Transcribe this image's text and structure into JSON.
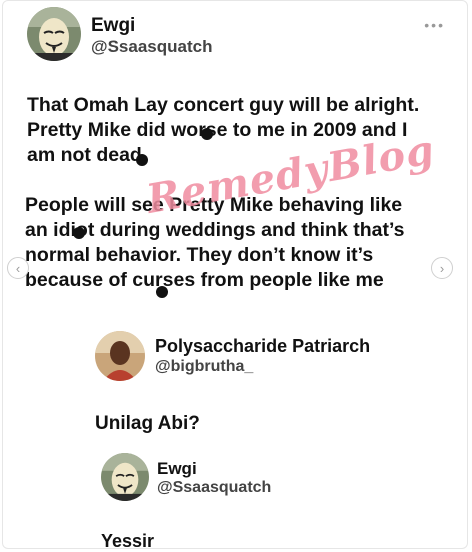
{
  "tweet1": {
    "name": "Ewgi",
    "handle": "@Ssaasquatch",
    "paragraph1": "That Omah Lay concert guy will be alright.\nPretty Mike did worse to me in 2009 and I\nam not dead",
    "paragraph2": "People will see Pretty Mike behaving like\nan idiot during weddings and think that’s\nnormal behavior. They don’t  know it’s\nbecause of curses from people like me"
  },
  "tweet2": {
    "name": "Polysaccharide Patriarch",
    "handle": "@bigbrutha_",
    "text": "Unilag Abi?"
  },
  "tweet3": {
    "name": "Ewgi",
    "handle": "@Ssaasquatch",
    "text": "Yessir"
  },
  "watermark": "RemedyBlog",
  "controls": {
    "more_icon": "more-dots-icon",
    "prev_icon": "chevron-left-icon",
    "next_icon": "chevron-right-icon"
  },
  "colors": {
    "watermark": "#f08da0",
    "handle": "#444444",
    "text": "#111111"
  }
}
